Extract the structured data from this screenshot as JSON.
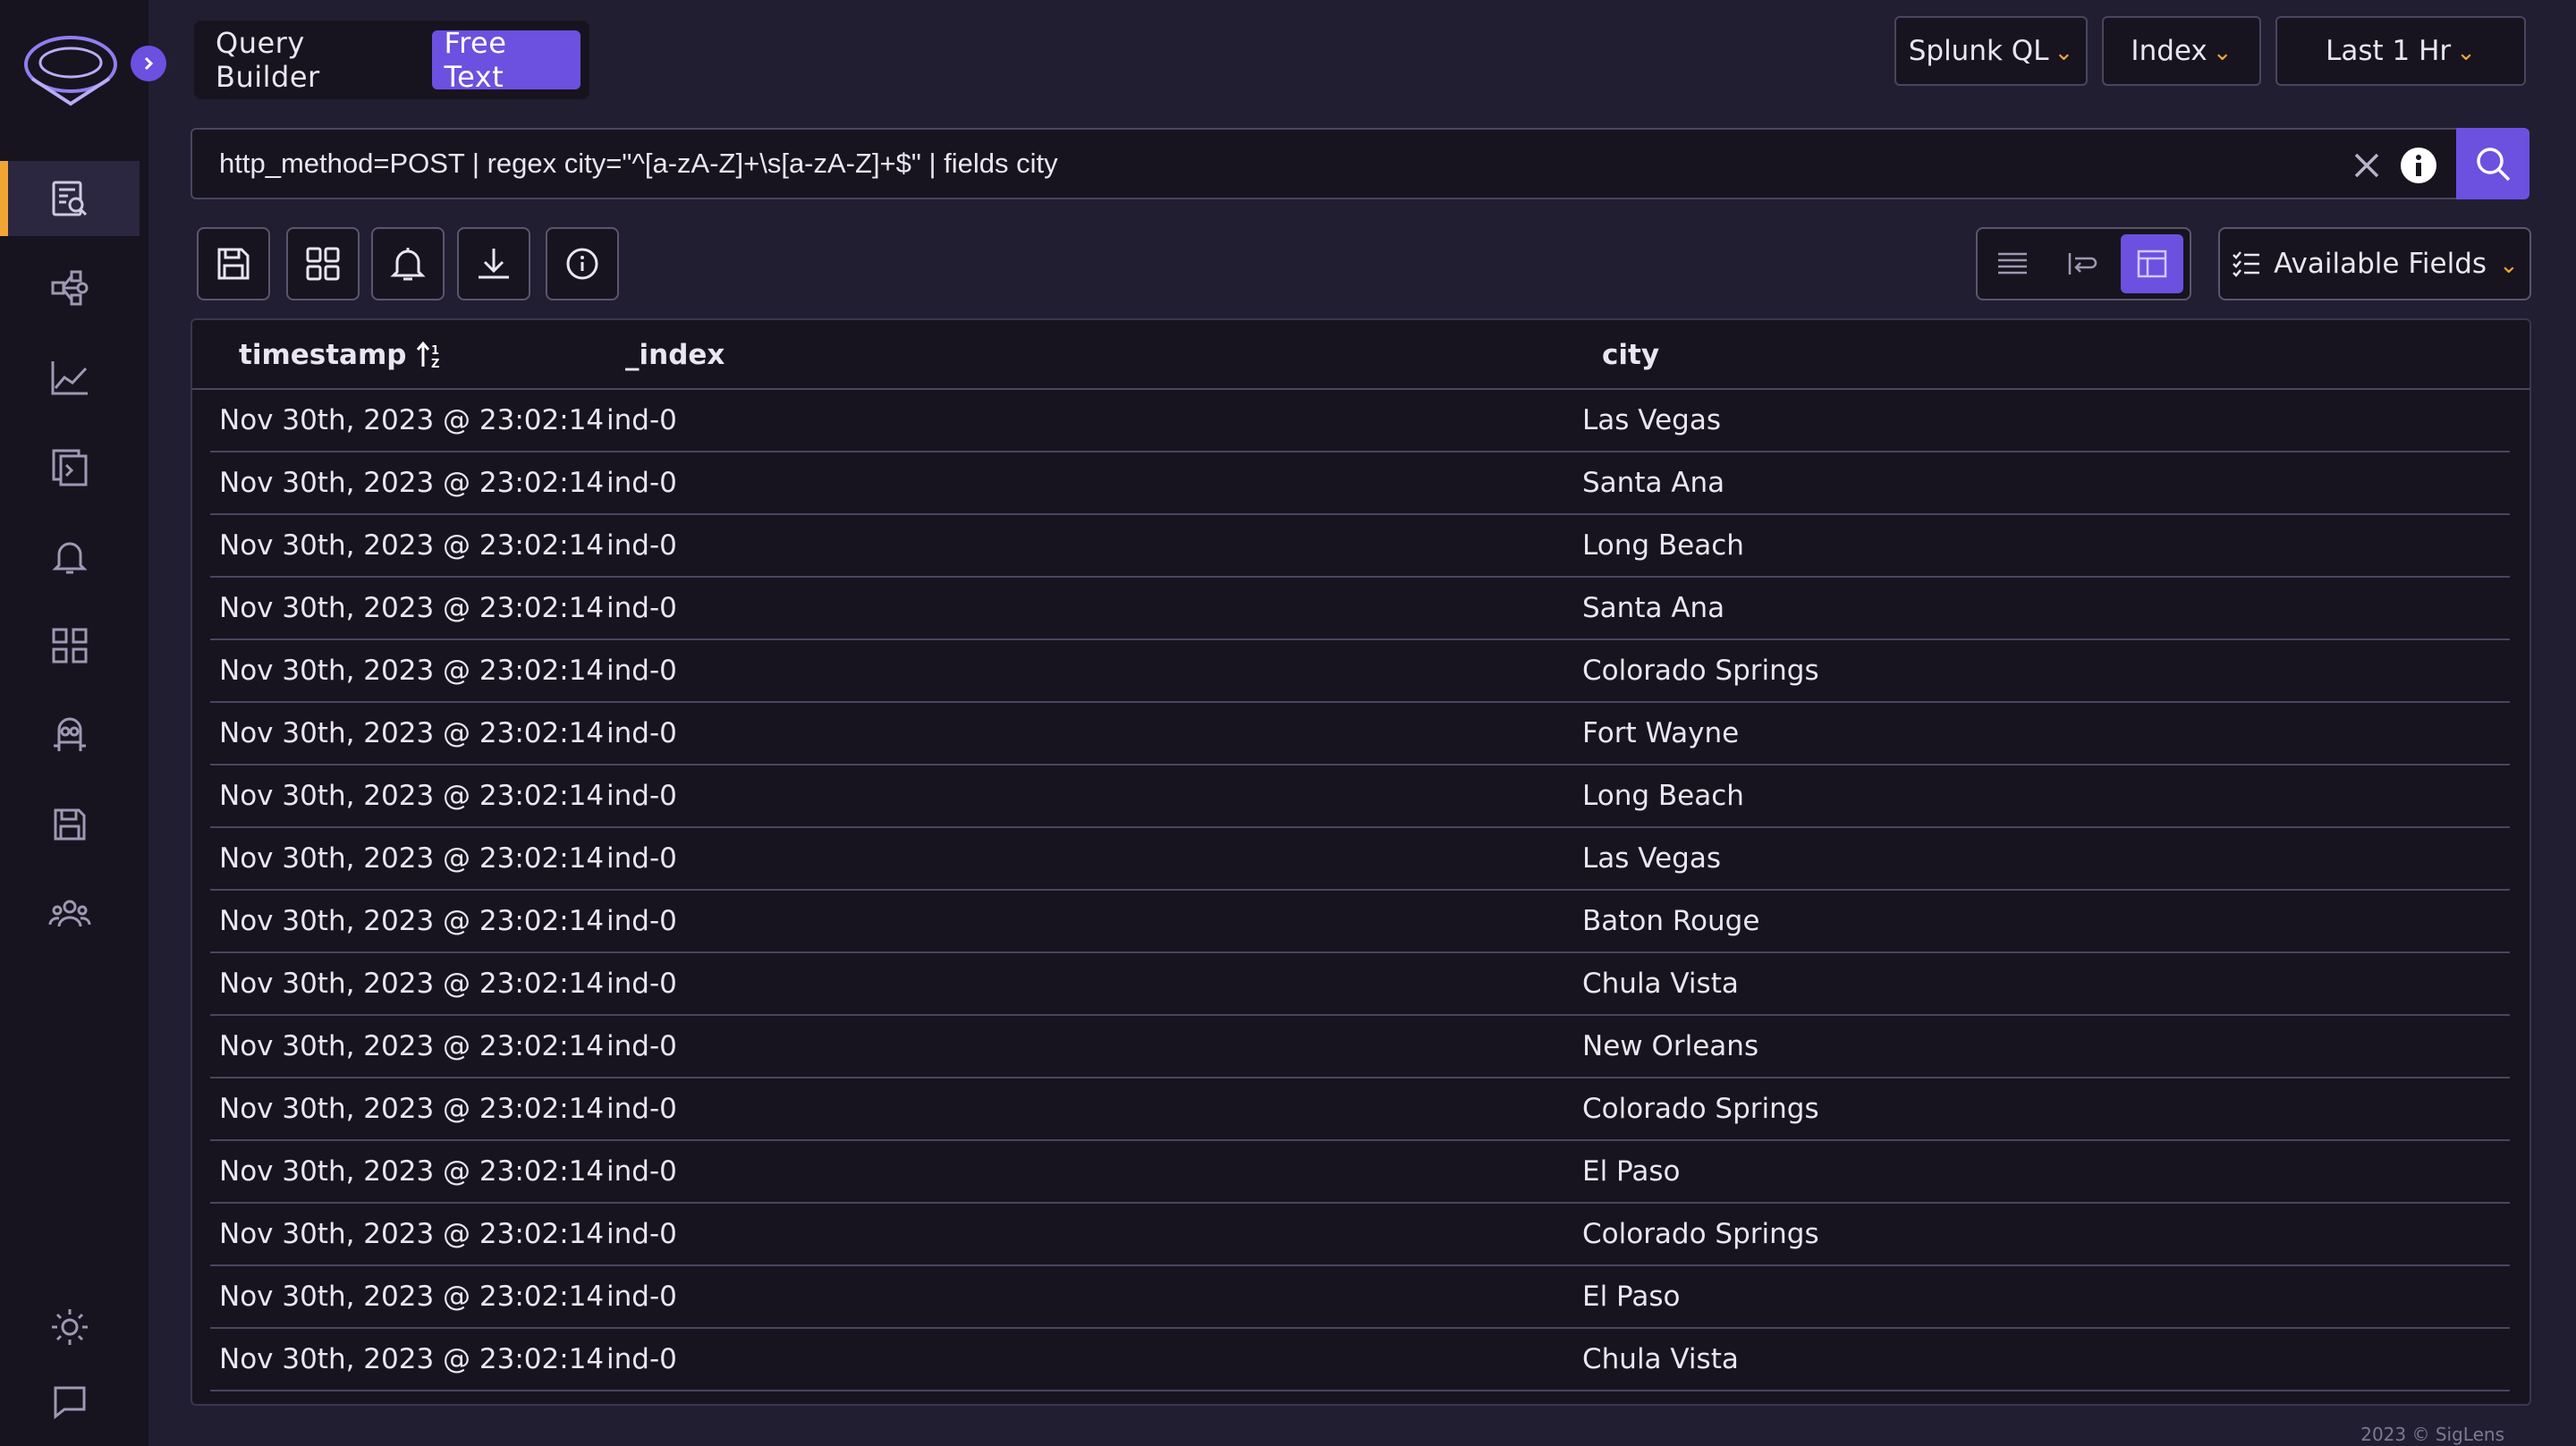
{
  "header": {
    "mode_toggle": [
      {
        "label": "Query Builder",
        "active": false
      },
      {
        "label": "Free Text",
        "active": true
      }
    ],
    "query_language": "Splunk QL",
    "index_label": "Index",
    "time_range": "Last 1 Hr"
  },
  "query": {
    "text": "http_method=POST | regex city=\"^[a-zA-Z]+\\s[a-zA-Z]+$\" | fields city"
  },
  "toolbar": {
    "available_fields_label": "Available Fields",
    "active_view": "table"
  },
  "table": {
    "columns": [
      "timestamp",
      "_index",
      "city"
    ],
    "rows": [
      [
        "Nov 30th, 2023 @ 23:02:14",
        "ind-0",
        "Las Vegas"
      ],
      [
        "Nov 30th, 2023 @ 23:02:14",
        "ind-0",
        "Santa Ana"
      ],
      [
        "Nov 30th, 2023 @ 23:02:14",
        "ind-0",
        "Long Beach"
      ],
      [
        "Nov 30th, 2023 @ 23:02:14",
        "ind-0",
        "Santa Ana"
      ],
      [
        "Nov 30th, 2023 @ 23:02:14",
        "ind-0",
        "Colorado Springs"
      ],
      [
        "Nov 30th, 2023 @ 23:02:14",
        "ind-0",
        "Fort Wayne"
      ],
      [
        "Nov 30th, 2023 @ 23:02:14",
        "ind-0",
        "Long Beach"
      ],
      [
        "Nov 30th, 2023 @ 23:02:14",
        "ind-0",
        "Las Vegas"
      ],
      [
        "Nov 30th, 2023 @ 23:02:14",
        "ind-0",
        "Baton Rouge"
      ],
      [
        "Nov 30th, 2023 @ 23:02:14",
        "ind-0",
        "Chula Vista"
      ],
      [
        "Nov 30th, 2023 @ 23:02:14",
        "ind-0",
        "New Orleans"
      ],
      [
        "Nov 30th, 2023 @ 23:02:14",
        "ind-0",
        "Colorado Springs"
      ],
      [
        "Nov 30th, 2023 @ 23:02:14",
        "ind-0",
        "El Paso"
      ],
      [
        "Nov 30th, 2023 @ 23:02:14",
        "ind-0",
        "Colorado Springs"
      ],
      [
        "Nov 30th, 2023 @ 23:02:14",
        "ind-0",
        "El Paso"
      ],
      [
        "Nov 30th, 2023 @ 23:02:14",
        "ind-0",
        "Chula Vista"
      ]
    ]
  },
  "footer": {
    "copyright": "2023 © SigLens"
  },
  "sidebar": {
    "items": [
      {
        "icon": "search-logs-icon",
        "active": true
      },
      {
        "icon": "service-graph-icon"
      },
      {
        "icon": "metrics-chart-icon"
      },
      {
        "icon": "live-tail-icon"
      },
      {
        "icon": "alerts-bell-icon"
      },
      {
        "icon": "dashboards-grid-icon"
      },
      {
        "icon": "minion-icon"
      },
      {
        "icon": "saved-queries-icon"
      },
      {
        "icon": "users-icon"
      }
    ]
  },
  "colors": {
    "accent": "#6c50e0",
    "highlight": "#f0a535",
    "background": "#221e31",
    "panel": "#17141f"
  }
}
